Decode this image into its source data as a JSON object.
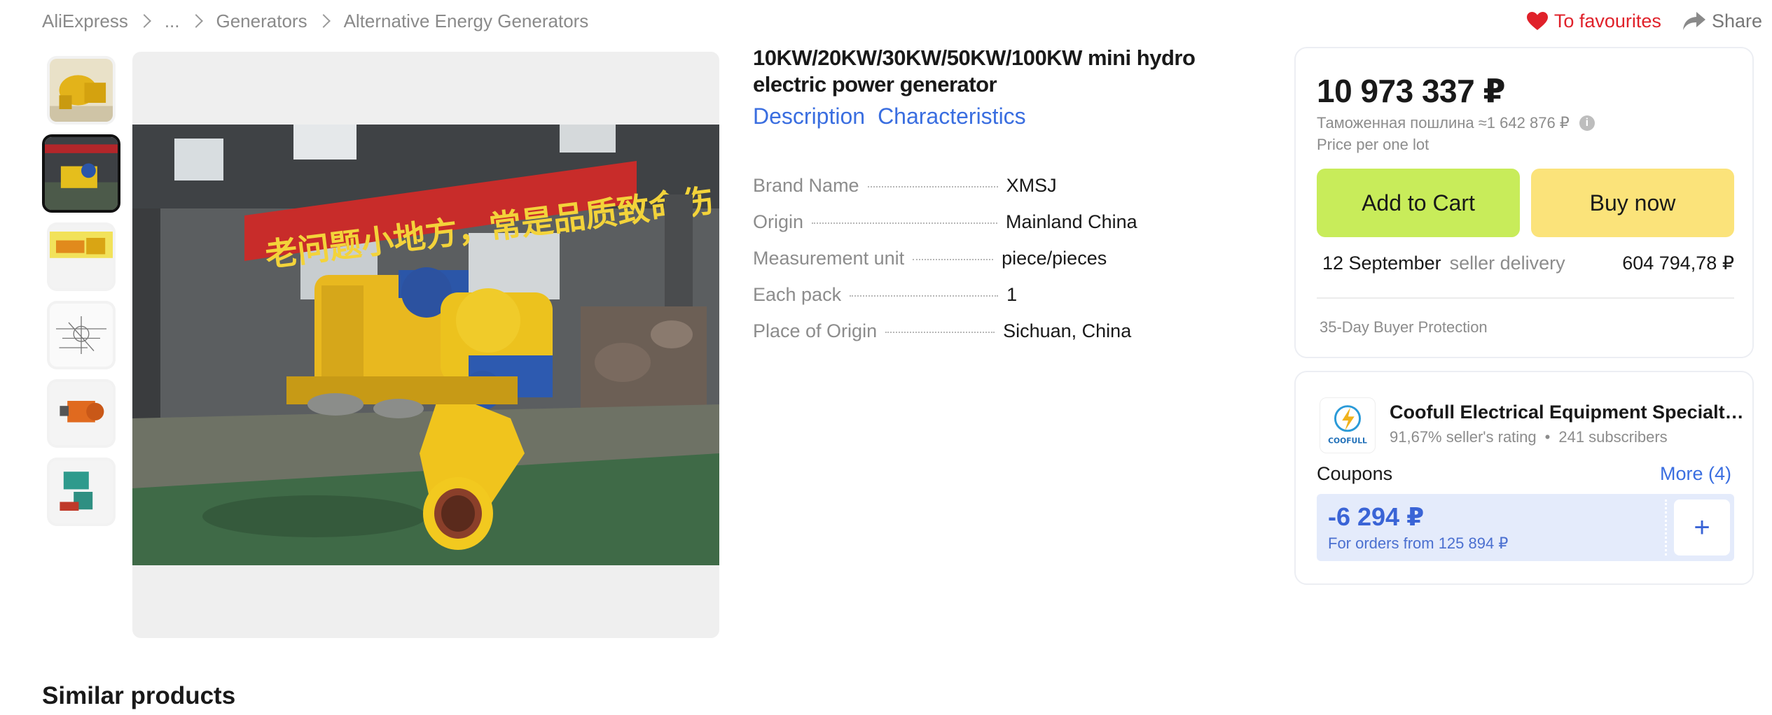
{
  "breadcrumb": {
    "items": [
      "AliExpress",
      "...",
      "Generators",
      "Alternative Energy Generators"
    ]
  },
  "actions": {
    "favourites": "To favourites",
    "share": "Share"
  },
  "product": {
    "title": "10KW/20KW/30KW/50KW/100KW mini hydro electric power generator",
    "tabs": [
      "Description",
      "Characteristics"
    ],
    "specs": [
      {
        "name": "Brand Name",
        "value": "XMSJ"
      },
      {
        "name": "Origin",
        "value": "Mainland China"
      },
      {
        "name": "Measurement unit",
        "value": "piece/pieces"
      },
      {
        "name": "Each pack",
        "value": "1"
      },
      {
        "name": "Place of Origin",
        "value": "Sichuan, China"
      }
    ],
    "photo_banner_text": "老问题小地方，常是品质致命伤"
  },
  "price_card": {
    "price": "10 973 337 ₽",
    "customs_duty": "Таможенная пошлина ≈1 642 876 ₽",
    "per_lot": "Price per one lot",
    "add_to_cart": "Add to Cart",
    "buy_now": "Buy now",
    "delivery_date": "12 September",
    "delivery_label": "seller delivery",
    "delivery_cost": "604 794,78 ₽",
    "protection": "35-Day Buyer Protection"
  },
  "seller": {
    "name": "Coofull Electrical Equipment Specialty Store",
    "logo_text": "COOFULL",
    "rating": "91,67% seller's rating",
    "subscribers": "241 subscribers",
    "coupons_label": "Coupons",
    "more": "More (4)",
    "coupon_amount": "-6 294 ₽",
    "coupon_condition": "For orders from 125 894 ₽"
  },
  "similar_title": "Similar products",
  "colors": {
    "accent_blue": "#3a6ee0",
    "favourite_red": "#e0212a",
    "cart_green": "#c8ec5a",
    "buy_yellow": "#fbe37a",
    "coupon_bg": "#e4ebfb"
  }
}
